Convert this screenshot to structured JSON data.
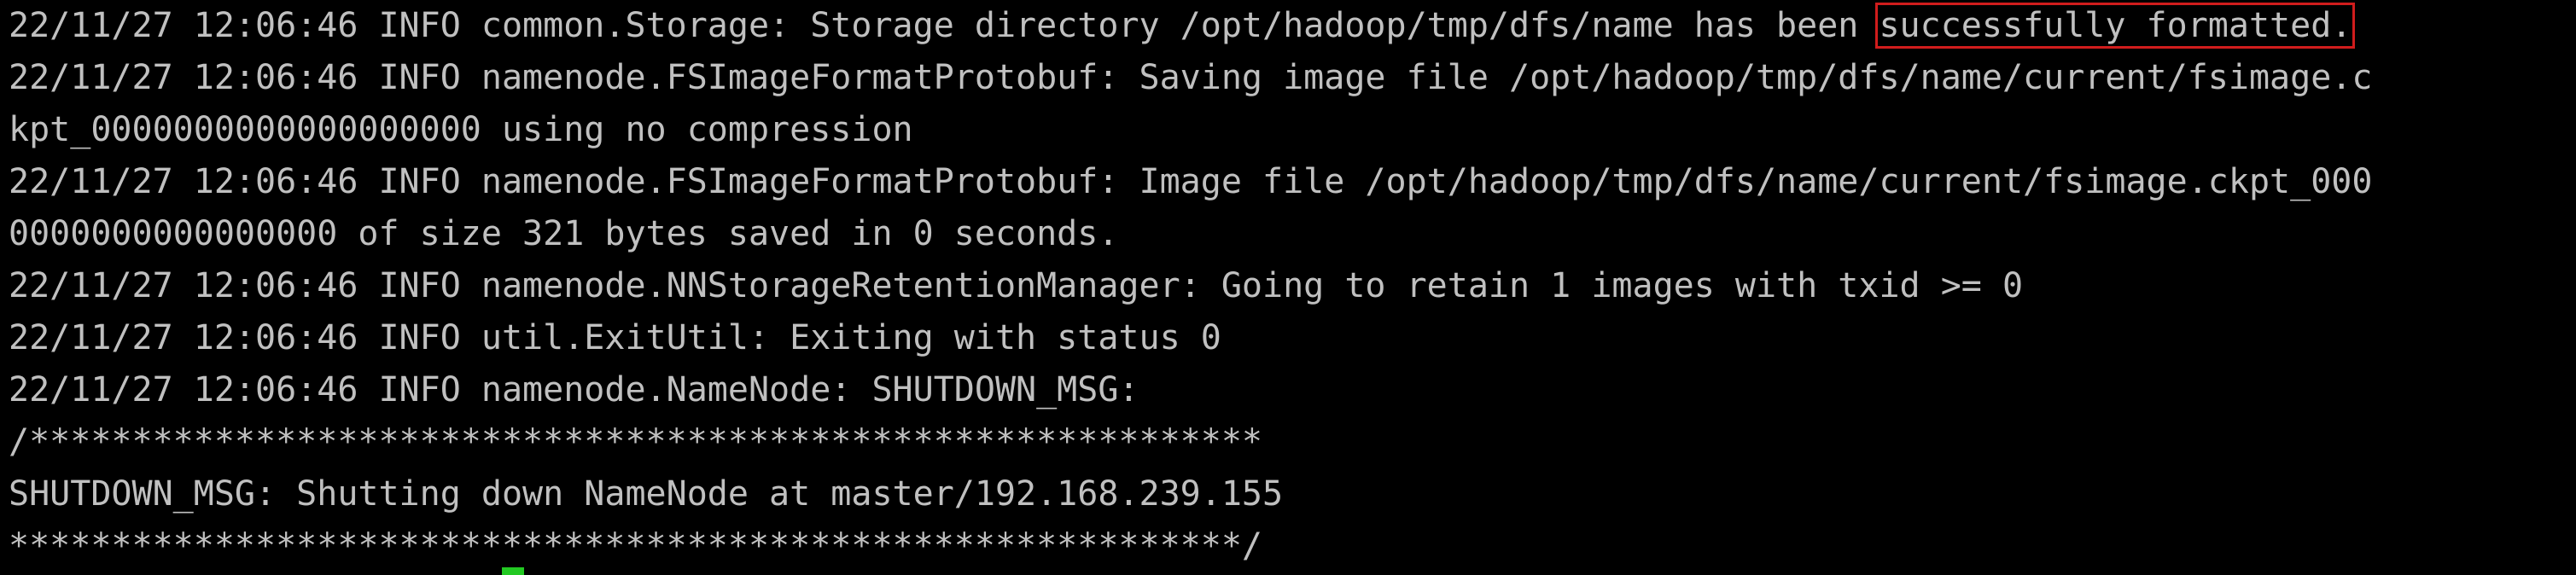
{
  "terminal": {
    "line_1_prefix": "22/11/27 12:06:46 INFO common.Storage: Storage directory /opt/hadoop/tmp/dfs/name has been ",
    "line_1_highlight": "successfully formatted.",
    "line_2": "22/11/27 12:06:46 INFO namenode.FSImageFormatProtobuf: Saving image file /opt/hadoop/tmp/dfs/name/current/fsimage.c",
    "line_3": "kpt_0000000000000000000 using no compression",
    "line_4": "22/11/27 12:06:46 INFO namenode.FSImageFormatProtobuf: Image file /opt/hadoop/tmp/dfs/name/current/fsimage.ckpt_000",
    "line_5": "0000000000000000 of size 321 bytes saved in 0 seconds.",
    "line_6": "22/11/27 12:06:46 INFO namenode.NNStorageRetentionManager: Going to retain 1 images with txid >= 0",
    "line_7": "22/11/27 12:06:46 INFO util.ExitUtil: Exiting with status 0",
    "line_8": "22/11/27 12:06:46 INFO namenode.NameNode: SHUTDOWN_MSG:",
    "line_9": "/************************************************************",
    "line_10": "SHUTDOWN_MSG: Shutting down NameNode at master/192.168.239.155",
    "line_11": "************************************************************/"
  },
  "colors": {
    "background": "#000000",
    "text": "#c0c0c0",
    "highlight_box": "#d01c1c",
    "cursor": "#22c922"
  }
}
